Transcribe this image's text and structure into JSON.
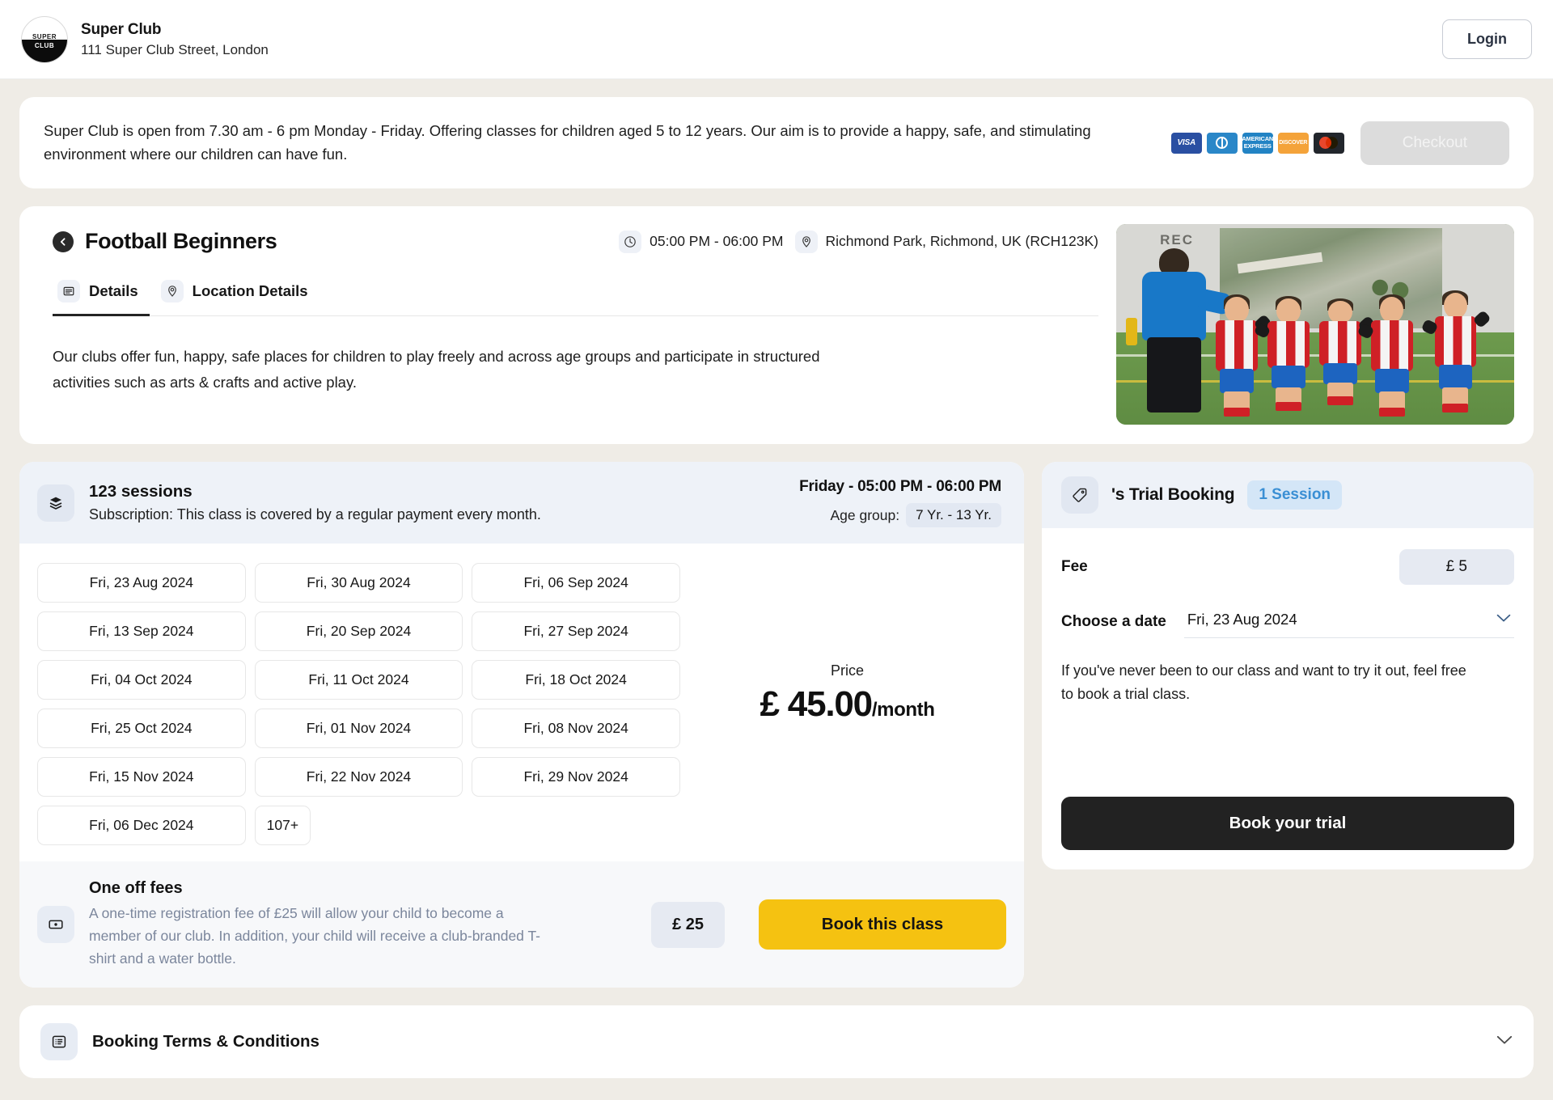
{
  "header": {
    "logo_line1": "SUPER",
    "logo_line2": "CLUB",
    "club_name": "Super Club",
    "club_address": "111 Super Club Street, London",
    "login_label": "Login"
  },
  "banner": {
    "text": "Super Club is open from 7.30 am - 6 pm Monday - Friday. Offering classes for children aged 5 to 12 years. Our aim is to provide a happy, safe, and stimulating environment where our children can have fun.",
    "payment_methods": [
      "VISA",
      "Diners Club",
      "AMERICAN EXPRESS",
      "DISCOVER",
      "Mastercard"
    ],
    "amex_label": "AMERICAN EXPRESS",
    "discover_label": "DISCOVER",
    "visa_label": "VISA",
    "checkout_label": "Checkout"
  },
  "class_detail": {
    "title": "Football Beginners",
    "time": "05:00 PM - 06:00 PM",
    "location": "Richmond Park, Richmond, UK (RCH123K)",
    "tabs": [
      {
        "label": "Details",
        "icon": "document-icon",
        "active": true
      },
      {
        "label": "Location Details",
        "icon": "map-pin-icon",
        "active": false
      }
    ],
    "description": "Our clubs offer fun, happy, safe places for children to play freely and across age groups and participate in structured activities such as arts & crafts and active play."
  },
  "sessions": {
    "count_label": "123 sessions",
    "subscription_note": "Subscription: This class is covered by a regular payment every month.",
    "schedule": "Friday - 05:00 PM - 06:00 PM",
    "age_group_label": "Age group:",
    "age_group_value": "7 Yr. - 13 Yr.",
    "dates": [
      "Fri, 23 Aug 2024",
      "Fri, 30 Aug 2024",
      "Fri, 06 Sep 2024",
      "Fri, 13 Sep 2024",
      "Fri, 20 Sep 2024",
      "Fri, 27 Sep 2024",
      "Fri, 04 Oct 2024",
      "Fri, 11 Oct 2024",
      "Fri, 18 Oct 2024",
      "Fri, 25 Oct 2024",
      "Fri, 01 Nov 2024",
      "Fri, 08 Nov 2024",
      "Fri, 15 Nov 2024",
      "Fri, 22 Nov 2024",
      "Fri, 29 Nov 2024",
      "Fri, 06 Dec 2024"
    ],
    "more_label": "107+",
    "price_label": "Price",
    "price_amount": "£ 45.00",
    "price_period": "/month"
  },
  "one_off_fees": {
    "title": "One off fees",
    "description": "A one-time registration fee of £25 will allow your child to become a member of our club. In addition, your child will receive a club-branded T-shirt and a water bottle.",
    "amount": "£ 25",
    "book_label": "Book this class"
  },
  "trial": {
    "title": "'s Trial Booking",
    "session_badge": "1 Session",
    "fee_label": "Fee",
    "fee_value": "£ 5",
    "date_label": "Choose a date",
    "date_value": "Fri, 23 Aug 2024",
    "note": "If you've never been to our class and want to try it out, feel free to book a trial class.",
    "book_label": "Book your trial"
  },
  "terms": {
    "title": "Booking Terms & Conditions"
  },
  "colors": {
    "accent_yellow": "#f5c211",
    "dark": "#222222",
    "panel_blue": "#eef2f8",
    "badge_blue": "#d4e6f7",
    "badge_blue_text": "#3a8fd4",
    "page_bg": "#efece6"
  }
}
